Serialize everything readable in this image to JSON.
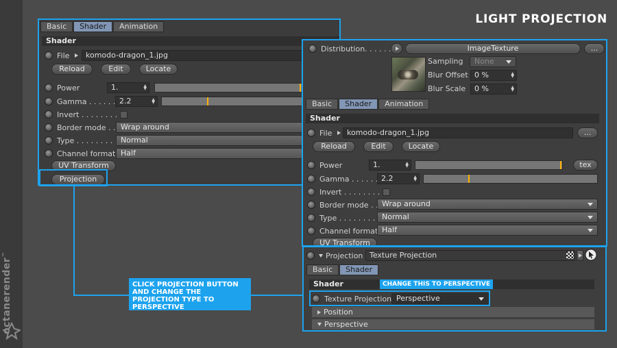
{
  "page_title": "LIGHT PROJECTION",
  "brand": "octanerender",
  "brand_tm": "™",
  "colors": {
    "accent": "#1da3ee",
    "slider_mark": "#ffb100",
    "active_tab": "#8296b5"
  },
  "left_panel": {
    "tabs": [
      "Basic",
      "Shader",
      "Animation"
    ],
    "section": "Shader",
    "file_label": "File",
    "file_value": "komodo-dragon_1.jpg",
    "reload": "Reload",
    "edit": "Edit",
    "locate": "Locate",
    "power_label": "Power",
    "power_value": "1.",
    "gamma_label": "Gamma . . . . . . .",
    "gamma_value": "2.2",
    "invert_label": "Invert . . . . . . . .",
    "border_label": "Border mode . .",
    "border_value": "Wrap around",
    "type_label": "Type . . . . . . . . .",
    "type_value": "Normal",
    "channel_label": "Channel format",
    "channel_value": "Half",
    "uv_transform": "UV Transform",
    "projection": "Projection"
  },
  "right_panel": {
    "distribution_label": "Distribution. . . . . . . .",
    "distribution_value": "ImageTexture",
    "dots_button": "...",
    "sampling_label": "Sampling",
    "sampling_value": "None",
    "blur_offset_label": "Blur Offset",
    "blur_offset_value": "0 %",
    "blur_scale_label": "Blur Scale",
    "blur_scale_value": "0 %",
    "tabs": [
      "Basic",
      "Shader",
      "Animation"
    ],
    "section": "Shader",
    "file_label": "File",
    "file_value": "komodo-dragon_1.jpg",
    "reload": "Reload",
    "edit": "Edit",
    "locate": "Locate",
    "power_label": "Power",
    "power_value": "1.",
    "tex_button": "tex",
    "gamma_label": "Gamma . . . . . . .",
    "gamma_value": "2.2",
    "invert_label": "Invert . . . . . . . .",
    "border_label": "Border mode . .",
    "border_value": "Wrap around",
    "type_label": "Type . . . . . . . . .",
    "type_value": "Normal",
    "channel_label": "Channel format",
    "channel_value": "Half",
    "uv_transform": "UV Transform"
  },
  "projection_panel": {
    "projection_label": "Projection",
    "projection_value": "Texture Projection",
    "tabs": [
      "Basic",
      "Shader"
    ],
    "section": "Shader",
    "texture_projection_label": "Texture Projection",
    "texture_projection_value": "Perspective",
    "position_label": "Position",
    "perspective_label": "Perspective"
  },
  "annotations": {
    "click_note": "CLICK PROJECTION BUTTON AND CHANGE THE PROJECTION TYPE TO PERSPECTIVE",
    "change_note": "CHANGE THIS TO PERSPECTIVE"
  }
}
